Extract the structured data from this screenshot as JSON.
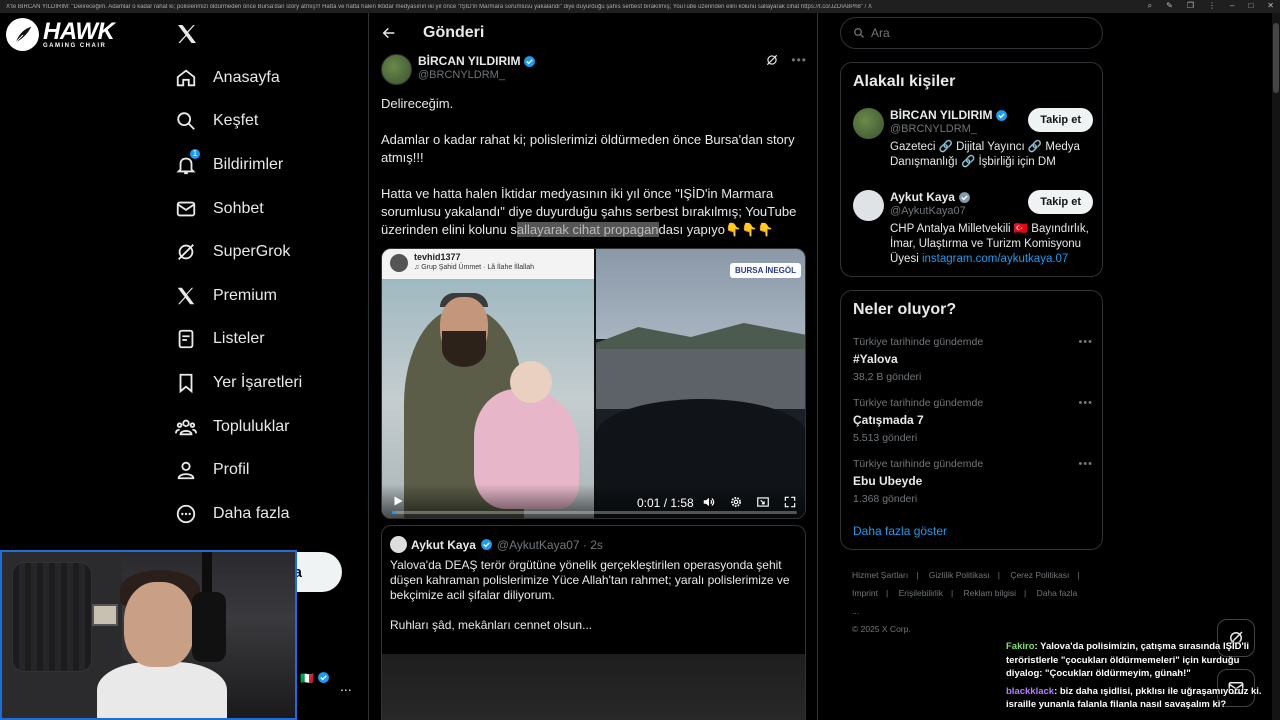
{
  "browser": {
    "tab_title": "X'te BİRCAN YILDIRIM: \"Delireceğim. Adamlar o kadar rahat ki; polislerimizi öldürmeden önce Bursa'dan story atmış!!! Hatta ve hatta halen İktidar medyasının iki yıl önce \"IŞİD'in Marmara sorumlusu yakalandı\" diye duyurduğu şahıs serbest bırakılmış; YouTube üzerinden elini kolunu sallayarak cihat https://t.co/JZDIA8Ph8\" / X"
  },
  "overlay_logo": {
    "brand": "HAWK",
    "sub": "GAMING CHAIR"
  },
  "nav": {
    "items": [
      {
        "label": "Anasayfa",
        "icon": "home-icon"
      },
      {
        "label": "Keşfet",
        "icon": "search-icon"
      },
      {
        "label": "Bildirimler",
        "icon": "bell-icon",
        "badge": "1"
      },
      {
        "label": "Sohbet",
        "icon": "mail-icon"
      },
      {
        "label": "SuperGrok",
        "icon": "grok-icon"
      },
      {
        "label": "Premium",
        "icon": "x-icon"
      },
      {
        "label": "Listeler",
        "icon": "list-icon"
      },
      {
        "label": "Yer İşaretleri",
        "icon": "bookmark-icon"
      },
      {
        "label": "Topluluklar",
        "icon": "people-icon"
      },
      {
        "label": "Profil",
        "icon": "person-icon"
      },
      {
        "label": "Daha fazla",
        "icon": "more-circle-icon"
      }
    ],
    "post_button": "a",
    "account_more": "..."
  },
  "header": {
    "title": "Gönderi"
  },
  "post": {
    "author_name": "BİRCAN YILDIRIM",
    "author_handle": "@BRCNYLDRM_",
    "p1": "Delireceğim.",
    "p2": "Adamlar o kadar rahat ki; polislerimizi öldürmeden önce Bursa'dan story atmış!!!",
    "p3_a": "Hatta ve hatta halen İktidar medyasının iki yıl önce \"IŞİD'in Marmara sorumlusu yakalandı\" diye duyurduğu şahıs serbest bırakılmış; YouTube üzerinden elini kolunu s",
    "p3_hl": "allayarak cihat propagan",
    "p3_b": "dası yapıyo👇👇👇"
  },
  "video": {
    "overlay_user": "tevhid1377",
    "overlay_sub": "♫ Grup Şahid Ümmet · Lâ İlahe İllallah",
    "location_tag": "BURSA İNEGÖL",
    "time": "0:01 / 1:58",
    "progress": 0.01
  },
  "quote": {
    "name": "Aykut Kaya",
    "handle": "@AykutKaya07 · 2s",
    "text1": "Yalova'da DEAŞ terör örgütüne yönelik gerçekleştirilen operasyonda şehit düşen kahraman polislerimize Yüce Allah'tan rahmet; yaralı polislerimize ve bekçimize acil şifalar diliyorum.",
    "text2": "Ruhları şâd, mekânları cennet olsun..."
  },
  "search": {
    "placeholder": "Ara"
  },
  "related": {
    "title": "Alakalı kişiler",
    "people": [
      {
        "name": "BİRCAN YILDIRIM",
        "handle": "@BRCNYLDRM_",
        "bio": "Gazeteci 🔗 Dijital Yayıncı 🔗 Medya Danışmanlığı 🔗 İşbirliği için DM",
        "link": "",
        "follow": "Takip et"
      },
      {
        "name": "Aykut Kaya",
        "handle": "@AykutKaya07",
        "bio": "CHP Antalya Milletvekili 🇹🇷 Bayındırlık, İmar, Ulaştırma ve Turizm Komisyonu Üyesi ",
        "link": "instagram.com/aykutkaya.07",
        "follow": "Takip et"
      }
    ]
  },
  "trends": {
    "title": "Neler oluyor?",
    "items": [
      {
        "context": "Türkiye tarihinde gündemde",
        "name": "#Yalova",
        "count": "38,2 B gönderi"
      },
      {
        "context": "Türkiye tarihinde gündemde",
        "name": "Çatışmada 7",
        "count": "5.513 gönderi"
      },
      {
        "context": "Türkiye tarihinde gündemde",
        "name": "Ebu Ubeyde",
        "count": "1.368 gönderi"
      }
    ],
    "show_more": "Daha fazla göster"
  },
  "footer": {
    "links": [
      "Hizmet Şartları",
      "Gizlilik Politikası",
      "Çerez Politikası",
      "Imprint",
      "Erişilebilirlik",
      "Reklam bilgisi",
      "Daha fazla ...",
      "© 2025 X Corp."
    ]
  },
  "chat": [
    {
      "user": "Fakiro",
      "text": ": Yalova'da polisimizin, çatışma sırasında IŞİD'li teröristlerle \"çocukları öldürmemeleri\" için kurduğu diyalog: \"Çocukları öldürmeyim, günah!\""
    },
    {
      "user": "blackklack",
      "text": ": biz daha ışidlisi, pkklısı ile uğraşamıyoruz ki. israille yunanla falanla filanla nasıl savaşalım ki?"
    }
  ],
  "colors": {
    "accent": "#1d9bf0",
    "background": "#000000",
    "border": "#2f3336",
    "muted": "#71767b"
  }
}
